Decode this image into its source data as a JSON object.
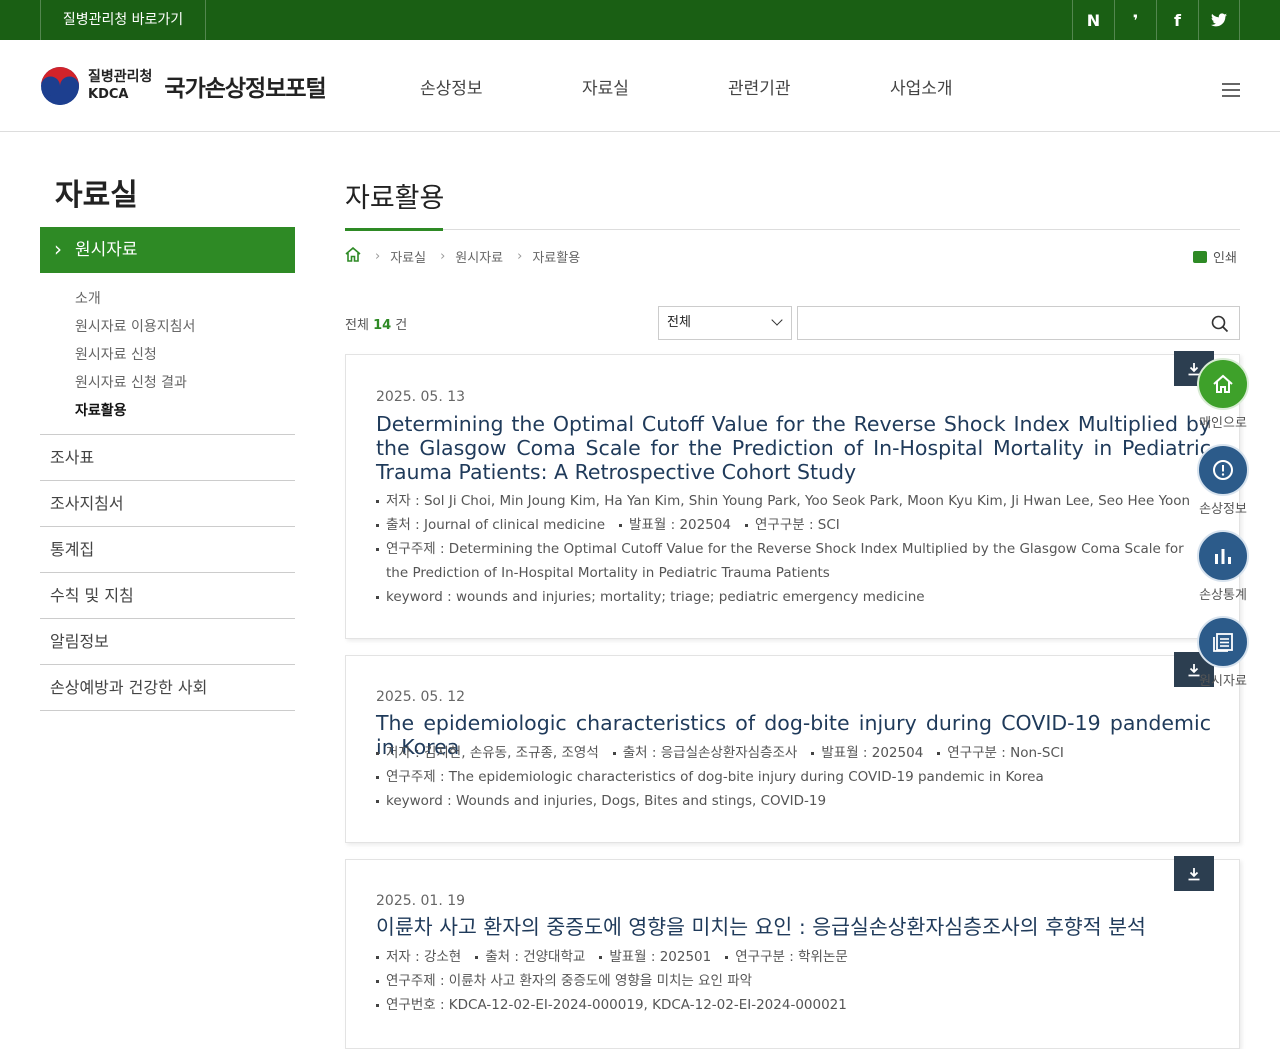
{
  "topbar": {
    "shortcut": "질병관리청 바로가기",
    "sns": [
      {
        "icon": "naver-icon",
        "glyph": "N"
      },
      {
        "icon": "blog-icon",
        "glyph": "❜"
      },
      {
        "icon": "facebook-icon",
        "glyph": "f"
      },
      {
        "icon": "twitter-icon",
        "glyph": "t"
      }
    ]
  },
  "header": {
    "org_ko": "질병관리청",
    "org_en": "KDCA",
    "portal": "국가손상정보포털",
    "nav": [
      "손상정보",
      "자료실",
      "관련기관",
      "사업소개"
    ]
  },
  "sidebar": {
    "title": "자료실",
    "active": "원시자료",
    "sub": [
      "소개",
      "원시자료 이용지침서",
      "원시자료 신청",
      "원시자료 신청 결과",
      "자료활용"
    ],
    "menu": [
      "조사표",
      "조사지침서",
      "통계집",
      "수칙 및 지침",
      "알림정보",
      "손상예방과 건강한 사회"
    ]
  },
  "main": {
    "title": "자료활용",
    "breadcrumb": [
      "자료실",
      "원시자료",
      "자료활용"
    ],
    "print": "인쇄",
    "total_prefix": "전체",
    "total_count": "14",
    "total_suffix": "건",
    "filter_selected": "전체",
    "search_value": ""
  },
  "cards": [
    {
      "date": "2025. 05. 13",
      "title": "Determining the Optimal Cutoff Value for the Reverse Shock Index Multiplied by the Glasgow Coma Scale for the Prediction of In-Hospital Mortality in Pediatric Trauma Patients: A Retrospective Cohort Study",
      "author": "저자 : Sol Ji Choi, Min Joung Kim, Ha Yan Kim, Shin Young Park, Yoo Seok Park, Moon Kyu Kim, Ji Hwan Lee, Seo Hee Yoon",
      "source": "출처 : Journal of clinical medicine",
      "pubmonth": "발표월 : 202504",
      "category": "연구구분 : SCI",
      "subject": "연구주제 : Determining the Optimal Cutoff Value for the Reverse Shock Index Multiplied by the Glasgow Coma Scale for the Prediction of In-Hospital Mortality in Pediatric Trauma Patients",
      "keyword": "keyword : wounds and injuries; mortality; triage; pediatric emergency medicine"
    },
    {
      "date": "2025. 05. 12",
      "title": "The epidemiologic characteristics of dog-bite injury during COVID-19 pandemic in Korea",
      "author": "저자 : 김지헌, 손유동, 조규종, 조영석",
      "source": "출처 : 응급실손상환자심층조사",
      "pubmonth": "발표월 : 202504",
      "category": "연구구분 : Non-SCI",
      "subject": "연구주제 : The epidemiologic characteristics of dog-bite injury during COVID-19 pandemic in Korea",
      "keyword": "keyword : Wounds and injuries, Dogs, Bites and stings, COVID-19"
    },
    {
      "date": "2025. 01. 19",
      "title": "이륜차 사고 환자의 중증도에 영향을 미치는 요인 : 응급실손상환자심층조사의 후향적 분석",
      "author": "저자 : 강소현",
      "source": "출처 : 건양대학교",
      "pubmonth": "발표월 : 202501",
      "category": "연구구분 : 학위논문",
      "subject": "연구주제 : 이륜차 사고 환자의 중증도에 영향을 미치는 요인 파악",
      "number": "연구번호 : KDCA-12-02-EI-2024-000019, KDCA-12-02-EI-2024-000021"
    }
  ],
  "quick": [
    {
      "label": "메인으로",
      "icon": "home-icon"
    },
    {
      "label": "손상정보",
      "icon": "info-icon"
    },
    {
      "label": "손상통계",
      "icon": "bar-chart-icon"
    },
    {
      "label": "원시자료",
      "icon": "document-list-icon"
    }
  ],
  "colors": {
    "topbar": "#1a5f14",
    "accent": "#2e8a25",
    "navy": "#2c3e50",
    "quick_blue": "#2c5b8a",
    "quick_green": "#3ea12a"
  }
}
